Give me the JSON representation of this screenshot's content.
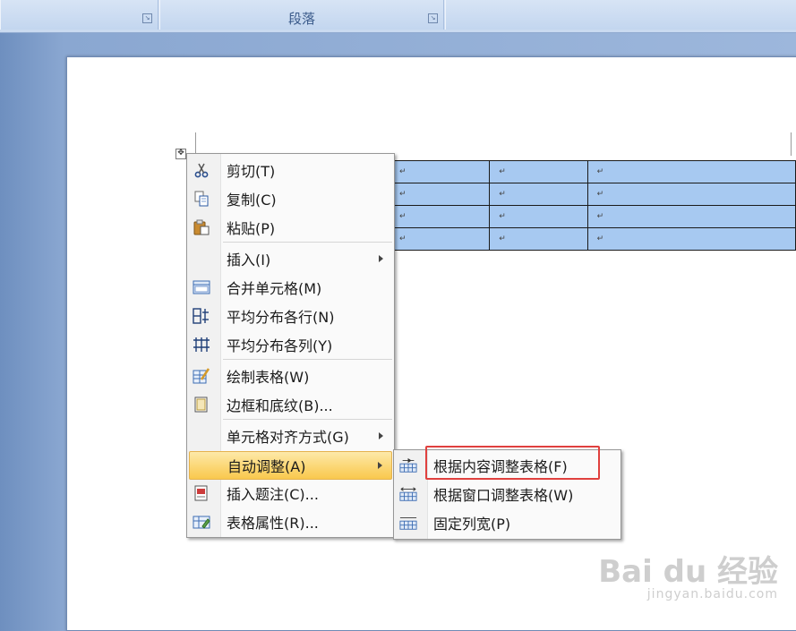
{
  "ribbon": {
    "group_paragraph_label": "段落"
  },
  "document": {
    "cell_mark": "↵",
    "table": [
      [
        "↵",
        "↵",
        "↵"
      ],
      [
        "↵",
        "↵",
        "↵"
      ],
      [
        "↵",
        "↵",
        "↵"
      ],
      [
        "↵",
        "↵",
        "↵"
      ]
    ]
  },
  "context_menu": {
    "cut": "剪切(T)",
    "copy": "复制(C)",
    "paste": "粘贴(P)",
    "insert": "插入(I)",
    "merge_cells": "合并单元格(M)",
    "distribute_rows": "平均分布各行(N)",
    "distribute_columns": "平均分布各列(Y)",
    "draw_table": "绘制表格(W)",
    "borders_shading": "边框和底纹(B)...",
    "cell_alignment": "单元格对齐方式(G)",
    "autofit": "自动调整(A)",
    "insert_caption": "插入题注(C)...",
    "table_properties": "表格属性(R)..."
  },
  "autofit_submenu": {
    "fit_contents": "根据内容调整表格(F)",
    "fit_window": "根据窗口调整表格(W)",
    "fixed_width": "固定列宽(P)"
  },
  "watermark": {
    "brand": "Bai du 经验",
    "url": "jingyan.baidu.com"
  },
  "colors": {
    "selection": "#a7c9f1",
    "highlight": "#fbd570",
    "callout": "#e0403e"
  }
}
